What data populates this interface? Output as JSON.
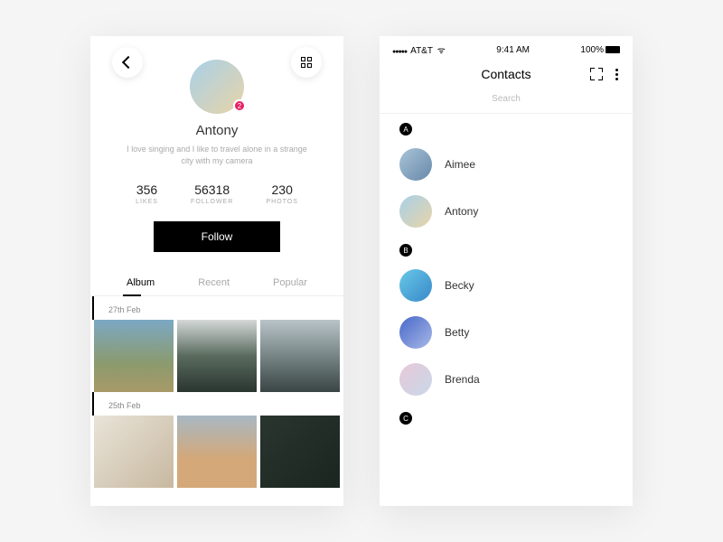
{
  "statusbar": {
    "carrier": "AT&T",
    "time": "9:41 AM",
    "battery": "100%"
  },
  "profile": {
    "badge": "2",
    "name": "Antony",
    "bio": "I love singing and I like to travel alone in a strange city with my camera",
    "stats": [
      {
        "value": "356",
        "label": "LIKES"
      },
      {
        "value": "56318",
        "label": "FOLLOWER"
      },
      {
        "value": "230",
        "label": "PHOTOS"
      }
    ],
    "follow_label": "Follow",
    "tabs": [
      "Album",
      "Recent",
      "Popular"
    ],
    "dates": [
      "27th Feb",
      "25th Feb"
    ]
  },
  "contacts": {
    "title": "Contacts",
    "search_placeholder": "Search",
    "sections": [
      {
        "letter": "A",
        "items": [
          "Aimee",
          "Antony"
        ]
      },
      {
        "letter": "B",
        "items": [
          "Becky",
          "Betty",
          "Brenda"
        ]
      },
      {
        "letter": "C",
        "items": []
      }
    ]
  }
}
